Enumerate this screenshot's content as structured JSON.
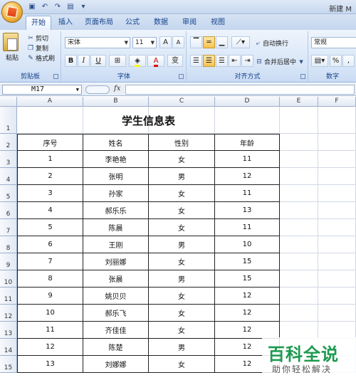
{
  "titlebar": {
    "doc_title": "新建 M"
  },
  "tabs": [
    {
      "label": "开始",
      "active": true
    },
    {
      "label": "插入"
    },
    {
      "label": "页面布局"
    },
    {
      "label": "公式"
    },
    {
      "label": "数据"
    },
    {
      "label": "审阅"
    },
    {
      "label": "视图"
    }
  ],
  "clipboard": {
    "paste": "粘贴",
    "cut": "剪切",
    "copy": "复制",
    "format_painter": "格式刷",
    "label": "剪贴板"
  },
  "font": {
    "name": "宋体",
    "size": "11",
    "grow": "A",
    "shrink": "A",
    "bold": "B",
    "italic": "I",
    "underline": "U",
    "label": "字体",
    "wen": "变"
  },
  "alignment": {
    "wrap": "自动换行",
    "merge": "合并后居中",
    "label": "对齐方式"
  },
  "number": {
    "format": "常规",
    "percent": "%",
    "comma": ",",
    "label": "数字"
  },
  "formula": {
    "cell_ref": "M17",
    "fx": "fx",
    "value": ""
  },
  "columns": [
    "A",
    "B",
    "C",
    "D",
    "E",
    "F"
  ],
  "rows": [
    "1",
    "2",
    "3",
    "4",
    "5",
    "6",
    "7",
    "8",
    "9",
    "10",
    "11",
    "12",
    "13",
    "14",
    "15"
  ],
  "sheet": {
    "title": "学生信息表",
    "headers": [
      "序号",
      "姓名",
      "性别",
      "年龄"
    ],
    "records": [
      [
        "1",
        "李艳艳",
        "女",
        "11"
      ],
      [
        "2",
        "张明",
        "男",
        "12"
      ],
      [
        "3",
        "孙家",
        "女",
        "11"
      ],
      [
        "4",
        "郝乐乐",
        "女",
        "13"
      ],
      [
        "5",
        "陈晨",
        "女",
        "11"
      ],
      [
        "6",
        "王刚",
        "男",
        "10"
      ],
      [
        "7",
        "刘丽娜",
        "女",
        "15"
      ],
      [
        "8",
        "张晨",
        "男",
        "15"
      ],
      [
        "9",
        "姚贝贝",
        "女",
        "12"
      ],
      [
        "10",
        "郝乐飞",
        "女",
        "12"
      ],
      [
        "11",
        "齐佳佳",
        "女",
        "12"
      ],
      [
        "12",
        "陈楚",
        "男",
        "12"
      ],
      [
        "13",
        "刘娜娜",
        "女",
        "12"
      ]
    ]
  },
  "watermark": {
    "main": "百科全说",
    "sub": "助你轻松解决"
  }
}
